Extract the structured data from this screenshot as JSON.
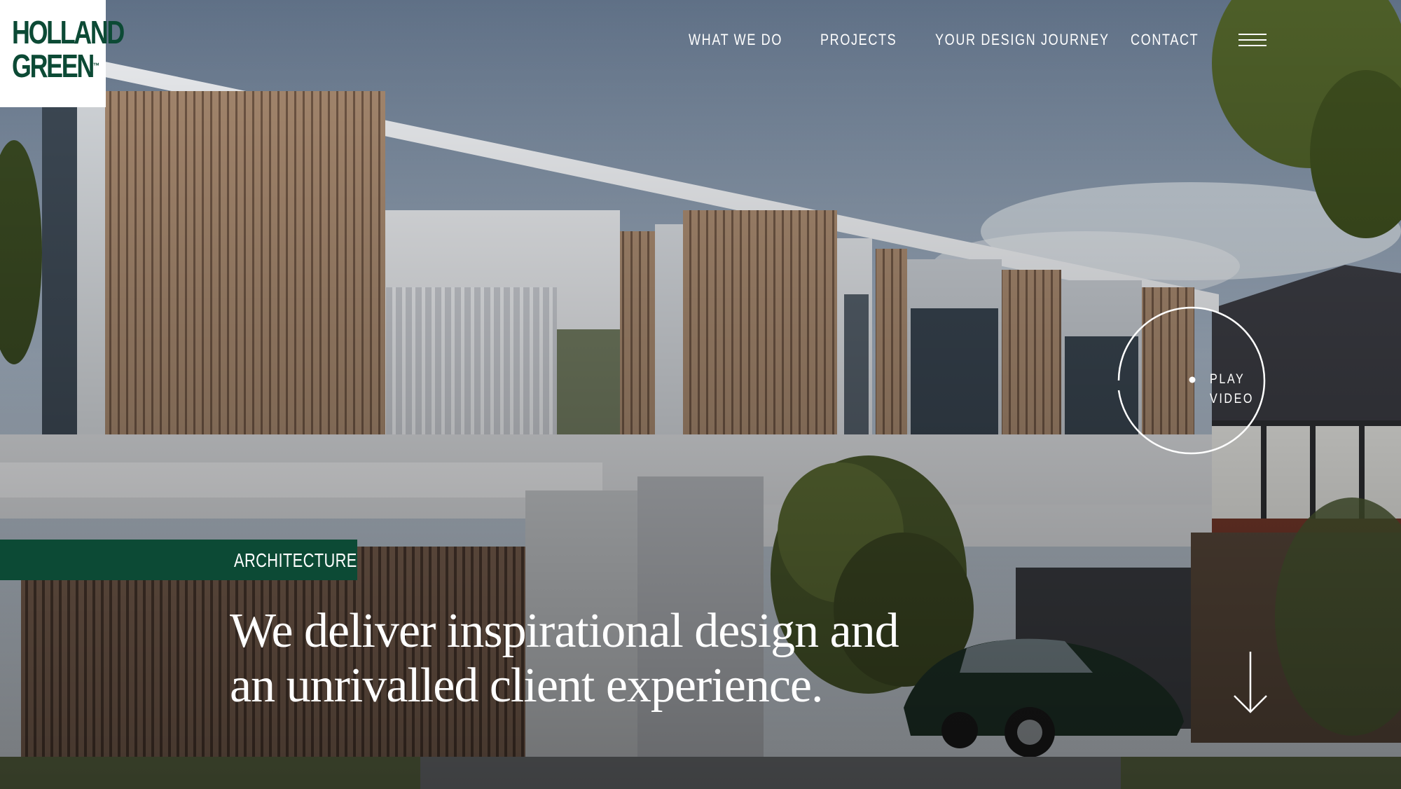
{
  "brand": {
    "logo_line1": "HOLLAND",
    "logo_line2": "GREEN",
    "logo_tm": "™",
    "color": "#0c4a35"
  },
  "nav": {
    "items": [
      {
        "label": "WHAT WE DO"
      },
      {
        "label": "PROJECTS"
      },
      {
        "label": "YOUR DESIGN JOURNEY"
      },
      {
        "label": "CONTACT"
      }
    ],
    "menu_icon": "hamburger-icon"
  },
  "play_video": {
    "line1": "PLAY",
    "line2": "VIDEO"
  },
  "hero": {
    "tag": "ARCHITECTURE",
    "headline_line1": "We deliver inspirational design and",
    "headline_line2": "an unrivalled client experience.",
    "scroll_icon": "arrow-down-icon"
  }
}
